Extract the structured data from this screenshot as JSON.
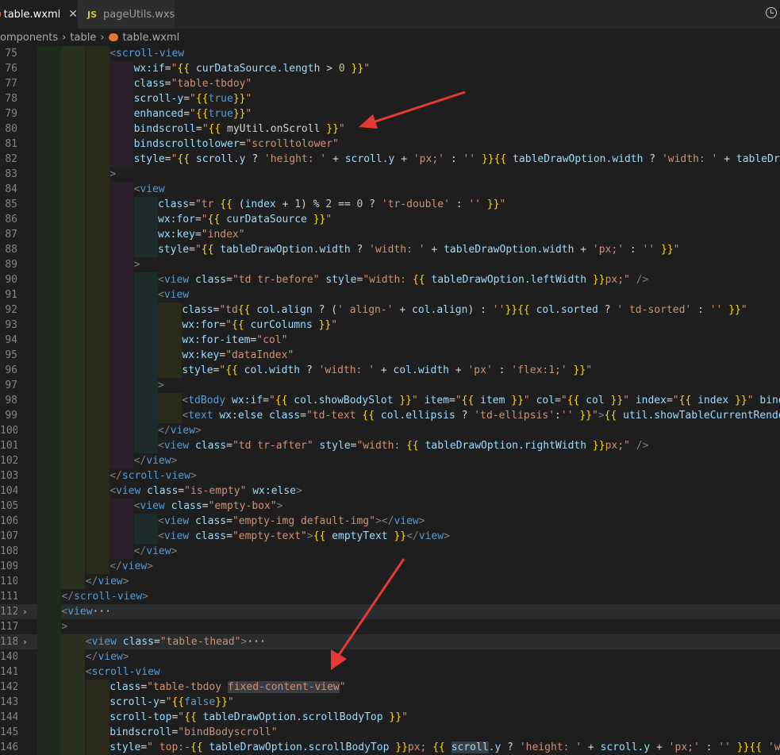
{
  "tabs": [
    {
      "label": "table.wxml",
      "active": true
    },
    {
      "label": "pageUtils.wxs",
      "badge": "JS",
      "active": false
    }
  ],
  "breadcrumb": [
    "omponents",
    "table",
    "table.wxml"
  ],
  "lines": [
    {
      "n": "75",
      "ind": 3,
      "html": "<span class='t'>&lt;</span><span class='tg'>scroll-view</span>"
    },
    {
      "n": "76",
      "ind": 4,
      "html": "<span class='a'>wx:if</span><span class='p'>=</span><span class='s'>\"</span><span class='bm'>{{</span><span class='v'> curDataSource.length </span><span class='o'>&gt; </span><span class='n'>0</span><span class='bm'> }}</span><span class='s'>\"</span>"
    },
    {
      "n": "77",
      "ind": 4,
      "html": "<span class='a'>class</span><span class='p'>=</span><span class='s'>\"table-tbdoy\"</span>"
    },
    {
      "n": "78",
      "ind": 4,
      "html": "<span class='a'>scroll-y</span><span class='p'>=</span><span class='s'>\"</span><span class='bm'>{{</span><span class='k'>true</span><span class='bm'>}}</span><span class='s'>\"</span>"
    },
    {
      "n": "79",
      "ind": 4,
      "html": "<span class='a'>enhanced</span><span class='p'>=</span><span class='s'>\"</span><span class='bm'>{{</span><span class='k'>true</span><span class='bm'>}}</span><span class='s'>\"</span>"
    },
    {
      "n": "80",
      "ind": 4,
      "html": "<span class='a'>bindscroll</span><span class='p'>=</span><span class='s'>\"</span><span class='bm'>{{</span><span class='p'> myUtil.onScroll </span><span class='bm'>}}</span><span class='s'>\"</span>"
    },
    {
      "n": "81",
      "ind": 4,
      "html": "<span class='a'>bindscrolltolower</span><span class='p'>=</span><span class='s'>\"scrolltolower\"</span>"
    },
    {
      "n": "82",
      "ind": 4,
      "html": "<span class='a'>style</span><span class='p'>=</span><span class='s'>\"</span><span class='bm'>{{</span><span class='v'> scroll.y </span><span class='o'>? </span><span class='s'>'height: ' </span><span class='o'>+ </span><span class='v'>scroll.y </span><span class='o'>+ </span><span class='s'>'px;' </span><span class='o'>: </span><span class='s'>'' </span><span class='bm'>}}{{</span><span class='v'> tableDrawOption.width </span><span class='o'>? </span><span class='s'>'width: ' </span><span class='o'>+ </span><span class='v'>tableDraw</span>"
    },
    {
      "n": "83",
      "ind": 3,
      "html": "<span class='t'>&gt;</span>"
    },
    {
      "n": "84",
      "ind": 4,
      "html": "<span class='t'>&lt;</span><span class='tg'>view</span>"
    },
    {
      "n": "85",
      "ind": 5,
      "html": "<span class='a'>class</span><span class='p'>=</span><span class='s'>\"tr </span><span class='bm'>{{</span><span class='o'> (</span><span class='v'>index </span><span class='o'>+ </span><span class='n'>1</span><span class='o'>) % </span><span class='n'>2 </span><span class='o'>== </span><span class='n'>0 </span><span class='o'>? </span><span class='s'>'tr-double' </span><span class='o'>: </span><span class='s'>'' </span><span class='bm'>}}</span><span class='s'>\"</span>"
    },
    {
      "n": "86",
      "ind": 5,
      "html": "<span class='a'>wx:for</span><span class='p'>=</span><span class='s'>\"</span><span class='bm'>{{</span><span class='v'> curDataSource </span><span class='bm'>}}</span><span class='s'>\"</span>"
    },
    {
      "n": "87",
      "ind": 5,
      "html": "<span class='a'>wx:key</span><span class='p'>=</span><span class='s'>\"index\"</span>"
    },
    {
      "n": "88",
      "ind": 5,
      "html": "<span class='a'>style</span><span class='p'>=</span><span class='s'>\"</span><span class='bm'>{{</span><span class='v'> tableDrawOption.width </span><span class='o'>? </span><span class='s'>'width: ' </span><span class='o'>+ </span><span class='v'>tableDrawOption.width </span><span class='o'>+ </span><span class='s'>'px;' </span><span class='o'>: </span><span class='s'>'' </span><span class='bm'>}}</span><span class='s'>\"</span>"
    },
    {
      "n": "89",
      "ind": 4,
      "html": "<span class='t'>&gt;</span>"
    },
    {
      "n": "90",
      "ind": 5,
      "html": "<span class='t'>&lt;</span><span class='tg'>view </span><span class='a'>class</span><span class='p'>=</span><span class='s'>\"td tr-before\" </span><span class='a'>style</span><span class='p'>=</span><span class='s'>\"width: </span><span class='bm'>{{</span><span class='v'> tableDrawOption.leftWidth </span><span class='bm'>}}</span><span class='s'>px;\" </span><span class='t'>/&gt;</span>"
    },
    {
      "n": "91",
      "ind": 5,
      "html": "<span class='t'>&lt;</span><span class='tg'>view</span>"
    },
    {
      "n": "92",
      "ind": 6,
      "html": "<span class='a'>class</span><span class='p'>=</span><span class='s'>\"td</span><span class='bm'>{{</span><span class='v'> col.align </span><span class='o'>? (</span><span class='s'>' align-' </span><span class='o'>+ </span><span class='v'>col.align</span><span class='o'>) : </span><span class='s'>''</span><span class='bm'>}}{{</span><span class='v'> col.sorted </span><span class='o'>? </span><span class='s'>' td-sorted' </span><span class='o'>: </span><span class='s'>'' </span><span class='bm'>}}</span><span class='s'>\"</span>"
    },
    {
      "n": "93",
      "ind": 6,
      "html": "<span class='a'>wx:for</span><span class='p'>=</span><span class='s'>\"</span><span class='bm'>{{</span><span class='v'> curColumns </span><span class='bm'>}}</span><span class='s'>\"</span>"
    },
    {
      "n": "94",
      "ind": 6,
      "html": "<span class='a'>wx:for-item</span><span class='p'>=</span><span class='s'>\"col\"</span>"
    },
    {
      "n": "95",
      "ind": 6,
      "html": "<span class='a'>wx:key</span><span class='p'>=</span><span class='s'>\"dataIndex\"</span>"
    },
    {
      "n": "96",
      "ind": 6,
      "html": "<span class='a'>style</span><span class='p'>=</span><span class='s'>\"</span><span class='bm'>{{</span><span class='v'> col.width </span><span class='o'>? </span><span class='s'>'width: ' </span><span class='o'>+ </span><span class='v'>col.width </span><span class='o'>+ </span><span class='s'>'px' </span><span class='o'>: </span><span class='s'>'flex:1;' </span><span class='bm'>}}</span><span class='s'>\"</span>"
    },
    {
      "n": "97",
      "ind": 5,
      "html": "<span class='t'>&gt;</span>"
    },
    {
      "n": "98",
      "ind": 6,
      "html": "<span class='t'>&lt;</span><span class='tg'>tdBody </span><span class='a'>wx:if</span><span class='p'>=</span><span class='s'>\"</span><span class='bm'>{{</span><span class='v'> col.showBodySlot </span><span class='bm'>}}</span><span class='s'>\" </span><span class='a'>item</span><span class='p'>=</span><span class='s'>\"</span><span class='bm'>{{</span><span class='v'> item </span><span class='bm'>}}</span><span class='s'>\" </span><span class='a'>col</span><span class='p'>=</span><span class='s'>\"</span><span class='bm'>{{</span><span class='v'> col </span><span class='bm'>}}</span><span class='s'>\" </span><span class='a'>index</span><span class='p'>=</span><span class='s'>\"</span><span class='bm'>{{</span><span class='v'> index </span><span class='bm'>}}</span><span class='s'>\" </span><span class='a'>bindc</span>"
    },
    {
      "n": "99",
      "ind": 6,
      "html": "<span class='t'>&lt;</span><span class='tg'>text </span><span class='a'>wx:else </span><span class='a'>class</span><span class='p'>=</span><span class='s'>\"td-text </span><span class='bm'>{{</span><span class='v'> col.ellipsis </span><span class='o'>? </span><span class='s'>'td-ellipsis'</span><span class='o'>:</span><span class='s'>'' </span><span class='bm'>}}</span><span class='s'>\"</span><span class='t'>&gt;</span><span class='bm'>{{</span><span class='v'> util.showTableCurrentRender</span>"
    },
    {
      "n": "100",
      "ind": 5,
      "html": "<span class='t'>&lt;/</span><span class='tg'>view</span><span class='t'>&gt;</span>"
    },
    {
      "n": "101",
      "ind": 5,
      "html": "<span class='t'>&lt;</span><span class='tg'>view </span><span class='a'>class</span><span class='p'>=</span><span class='s'>\"td tr-after\" </span><span class='a'>style</span><span class='p'>=</span><span class='s'>\"width: </span><span class='bm'>{{</span><span class='v'> tableDrawOption.rightWidth </span><span class='bm'>}}</span><span class='s'>px;\" </span><span class='t'>/&gt;</span>"
    },
    {
      "n": "102",
      "ind": 4,
      "html": "<span class='t'>&lt;/</span><span class='tg'>view</span><span class='t'>&gt;</span>"
    },
    {
      "n": "103",
      "ind": 3,
      "html": "<span class='t'>&lt;/</span><span class='tg'>scroll-view</span><span class='t'>&gt;</span>"
    },
    {
      "n": "104",
      "ind": 3,
      "html": "<span class='t'>&lt;</span><span class='tg'>view </span><span class='a'>class</span><span class='p'>=</span><span class='s'>\"is-empty\" </span><span class='a'>wx:else</span><span class='t'>&gt;</span>"
    },
    {
      "n": "105",
      "ind": 4,
      "html": "<span class='t'>&lt;</span><span class='tg'>view </span><span class='a'>class</span><span class='p'>=</span><span class='s'>\"empty-box\"</span><span class='t'>&gt;</span>"
    },
    {
      "n": "106",
      "ind": 5,
      "html": "<span class='t'>&lt;</span><span class='tg'>view </span><span class='a'>class</span><span class='p'>=</span><span class='s'>\"empty-img default-img\"</span><span class='t'>&gt;&lt;/</span><span class='tg'>view</span><span class='t'>&gt;</span>"
    },
    {
      "n": "107",
      "ind": 5,
      "html": "<span class='t'>&lt;</span><span class='tg'>view </span><span class='a'>class</span><span class='p'>=</span><span class='s'>\"empty-text\"</span><span class='t'>&gt;</span><span class='bm'>{{</span><span class='v'> emptyText </span><span class='bm'>}}</span><span class='t'>&lt;/</span><span class='tg'>view</span><span class='t'>&gt;</span>"
    },
    {
      "n": "108",
      "ind": 4,
      "html": "<span class='t'>&lt;/</span><span class='tg'>view</span><span class='t'>&gt;</span>"
    },
    {
      "n": "109",
      "ind": 3,
      "html": "<span class='t'>&lt;/</span><span class='tg'>view</span><span class='t'>&gt;</span>"
    },
    {
      "n": "110",
      "ind": 2,
      "html": "<span class='t'>&lt;/</span><span class='tg'>view</span><span class='t'>&gt;</span>"
    },
    {
      "n": "111",
      "ind": 1,
      "html": "<span class='t'>&lt;/</span><span class='tg'>scroll-view</span><span class='t'>&gt;</span>"
    },
    {
      "n": "112",
      "ind": 1,
      "fold": true,
      "cur": true,
      "html": "<span class='t'>&lt;</span><span class='tg'>view</span><span class='p'>···</span>"
    },
    {
      "n": "117",
      "ind": 1,
      "html": "<span class='t'>&gt;</span>"
    },
    {
      "n": "118",
      "ind": 2,
      "fold": true,
      "cur": true,
      "html": "<span class='t'>&lt;</span><span class='tg'>view </span><span class='a'>class</span><span class='p'>=</span><span class='s'>\"table-thead\"</span><span class='t'>&gt;</span><span class='p'>···</span>"
    },
    {
      "n": "140",
      "ind": 2,
      "html": "<span class='t'>&lt;/</span><span class='tg'>view</span><span class='t'>&gt;</span>"
    },
    {
      "n": "141",
      "ind": 2,
      "html": "<span class='t'>&lt;</span><span class='tg'>scroll-view</span>"
    },
    {
      "n": "142",
      "ind": 3,
      "html": "<span class='a'>class</span><span class='p'>=</span><span class='s'>\"table-tbdoy </span><span class='s hl2'>fixed-content-view</span><span class='s'>\"</span>"
    },
    {
      "n": "143",
      "ind": 3,
      "html": "<span class='a'>scroll-y</span><span class='p'>=</span><span class='s'>\"</span><span class='bm'>{{</span><span class='k'>false</span><span class='bm'>}}</span><span class='s'>\"</span>"
    },
    {
      "n": "144",
      "ind": 3,
      "html": "<span class='a'>scroll-top</span><span class='p'>=</span><span class='s'>\"</span><span class='bm'>{{</span><span class='v'> tableDrawOption.scrollBodyTop </span><span class='bm'>}}</span><span class='s'>\"</span>"
    },
    {
      "n": "145",
      "ind": 3,
      "html": "<span class='a'>bindscroll</span><span class='p'>=</span><span class='s'>\"bindBodyscroll\"</span>"
    },
    {
      "n": "146",
      "ind": 3,
      "html": "<span class='a'>style</span><span class='p'>=</span><span class='s'>\" top:-</span><span class='bm'>{{</span><span class='v'> tableDrawOption.scrollBodyTop </span><span class='bm'>}}</span><span class='s'>px; </span><span class='bm'>{{</span><span class='v'> </span><span class='v hl2'>scroll</span><span class='v'>.y </span><span class='o'>? </span><span class='s'>'height: ' </span><span class='o'>+ </span><span class='v'>scroll.y </span><span class='o'>+ </span><span class='s'>'px;' </span><span class='o'>: </span><span class='s'>'' </span><span class='bm'>}}{{</span><span class='s'> 'wid</span>"
    }
  ]
}
